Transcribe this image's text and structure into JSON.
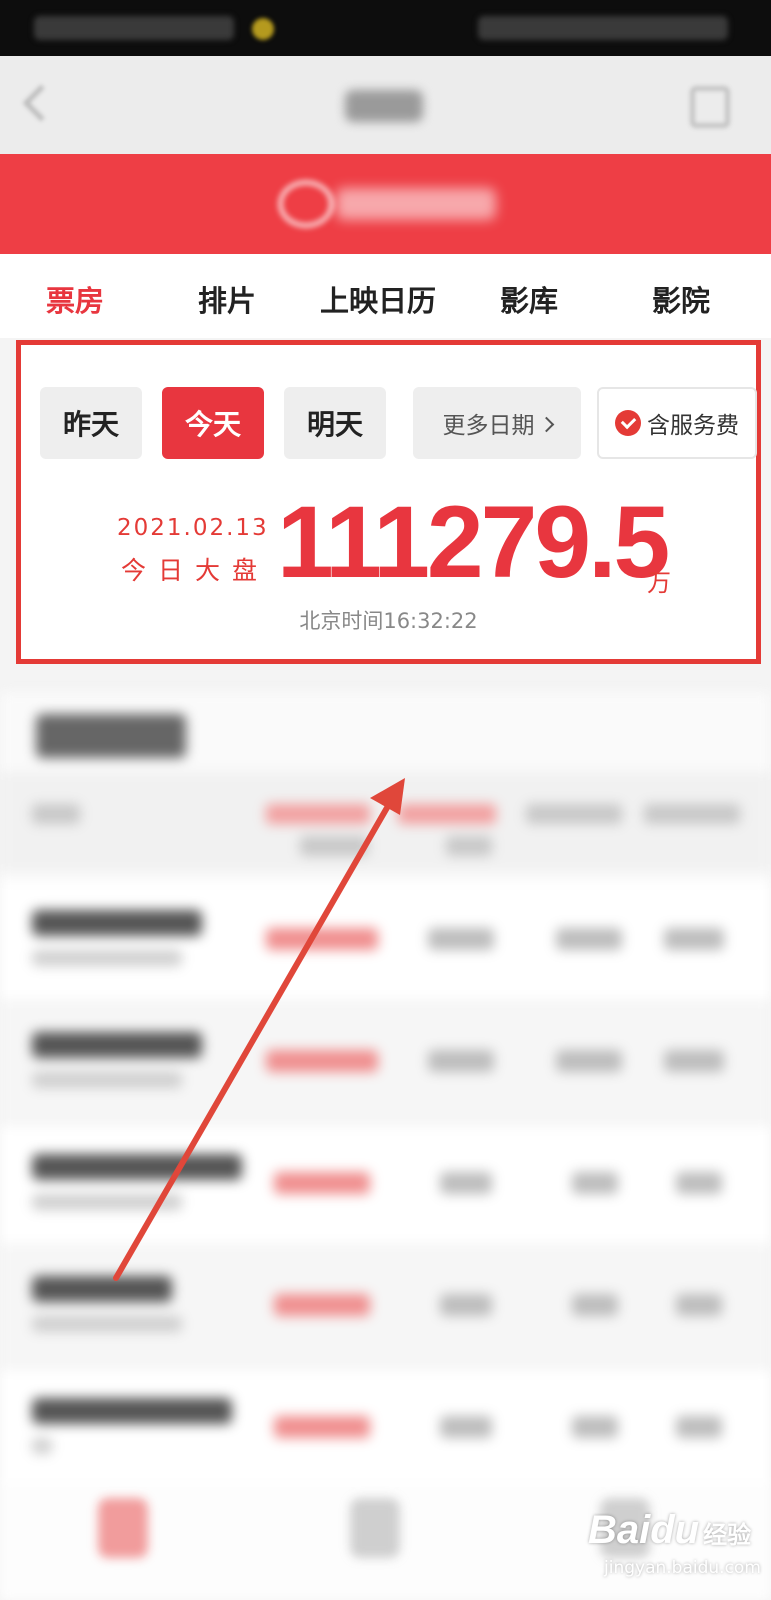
{
  "tabs": [
    {
      "label": "票房",
      "active": true
    },
    {
      "label": "排片",
      "active": false
    },
    {
      "label": "上映日历",
      "active": false
    },
    {
      "label": "影库",
      "active": false
    },
    {
      "label": "影院",
      "active": false
    }
  ],
  "date_filters": {
    "yesterday": "昨天",
    "today": "今天",
    "tomorrow": "明天",
    "more_dates": "更多日期",
    "include_service_fee": "含服务费",
    "selected": "今天",
    "service_fee_checked": true
  },
  "summary": {
    "date": "2021.02.13",
    "label": "今日大盘",
    "total": "111279.5",
    "unit": "万",
    "time_label": "北京时间16:32:22"
  },
  "watermark": {
    "brand": "Bai",
    "brand_suffix": "du",
    "brand_cn": "经验",
    "site": "jingyan.baidu.com"
  },
  "colors": {
    "accent": "#e8363f",
    "highlight_border": "#e43a36",
    "annotation_arrow": "#e0473a"
  }
}
